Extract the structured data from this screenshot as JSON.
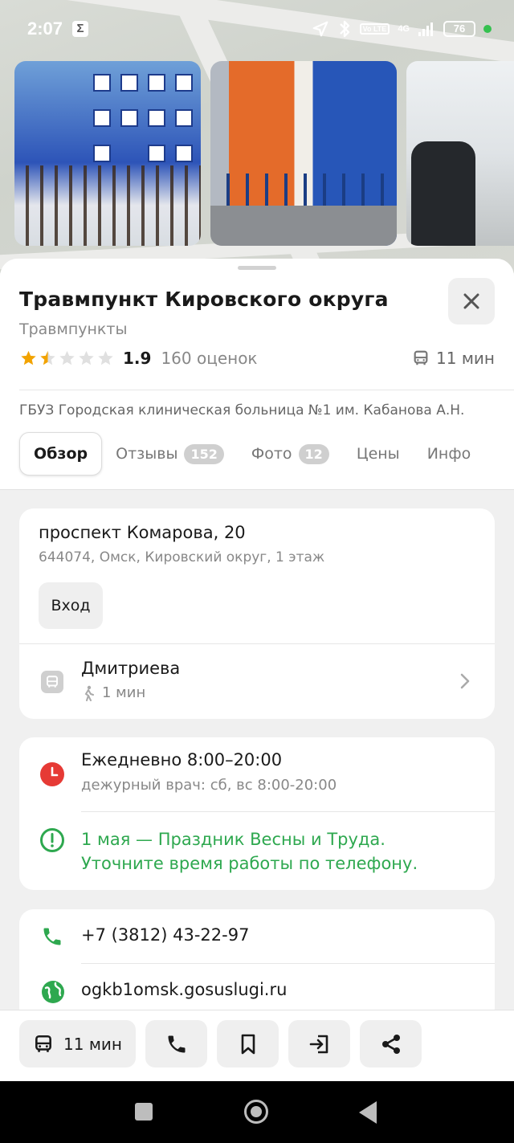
{
  "status_bar": {
    "time": "2:07",
    "sigma": "Σ",
    "network": "4G",
    "lte": "Vo LTE",
    "battery": "76"
  },
  "place": {
    "title": "Травмпункт Кировского округа",
    "category": "Травмпункты",
    "rating": "1.9",
    "rating_fraction": 0.38,
    "rating_count": "160 оценок",
    "transit_time": "11 мин",
    "organization": "ГБУЗ Городская клиническая больница №1 им. Кабанова А.Н."
  },
  "tabs": [
    {
      "label": "Обзор",
      "badge": null
    },
    {
      "label": "Отзывы",
      "badge": "152"
    },
    {
      "label": "Фото",
      "badge": "12"
    },
    {
      "label": "Цены",
      "badge": null
    },
    {
      "label": "Инфо",
      "badge": null
    }
  ],
  "address": {
    "main": "проспект Комарова, 20",
    "sub": "644074, Омск, Кировский округ, 1 этаж",
    "entrance_label": "Вход"
  },
  "stop": {
    "name": "Дмитриева",
    "walk": "1 мин"
  },
  "hours": {
    "main": "Ежедневно 8:00–20:00",
    "sub": "дежурный врач: сб, вс 8:00-20:00",
    "holiday_line1": "1 мая — Праздник Весны и Труда.",
    "holiday_line2": "Уточните время работы по телефону."
  },
  "contacts": {
    "phone": "+7 (3812) 43-22-97",
    "website": "ogkb1omsk.gosuslugi.ru"
  },
  "actions": {
    "route_label": "11 мин"
  },
  "colors": {
    "star_filled": "#f2a300",
    "star_empty": "#e0e0e0",
    "accent_green": "#2ea84f",
    "clock_red": "#e63a35"
  }
}
